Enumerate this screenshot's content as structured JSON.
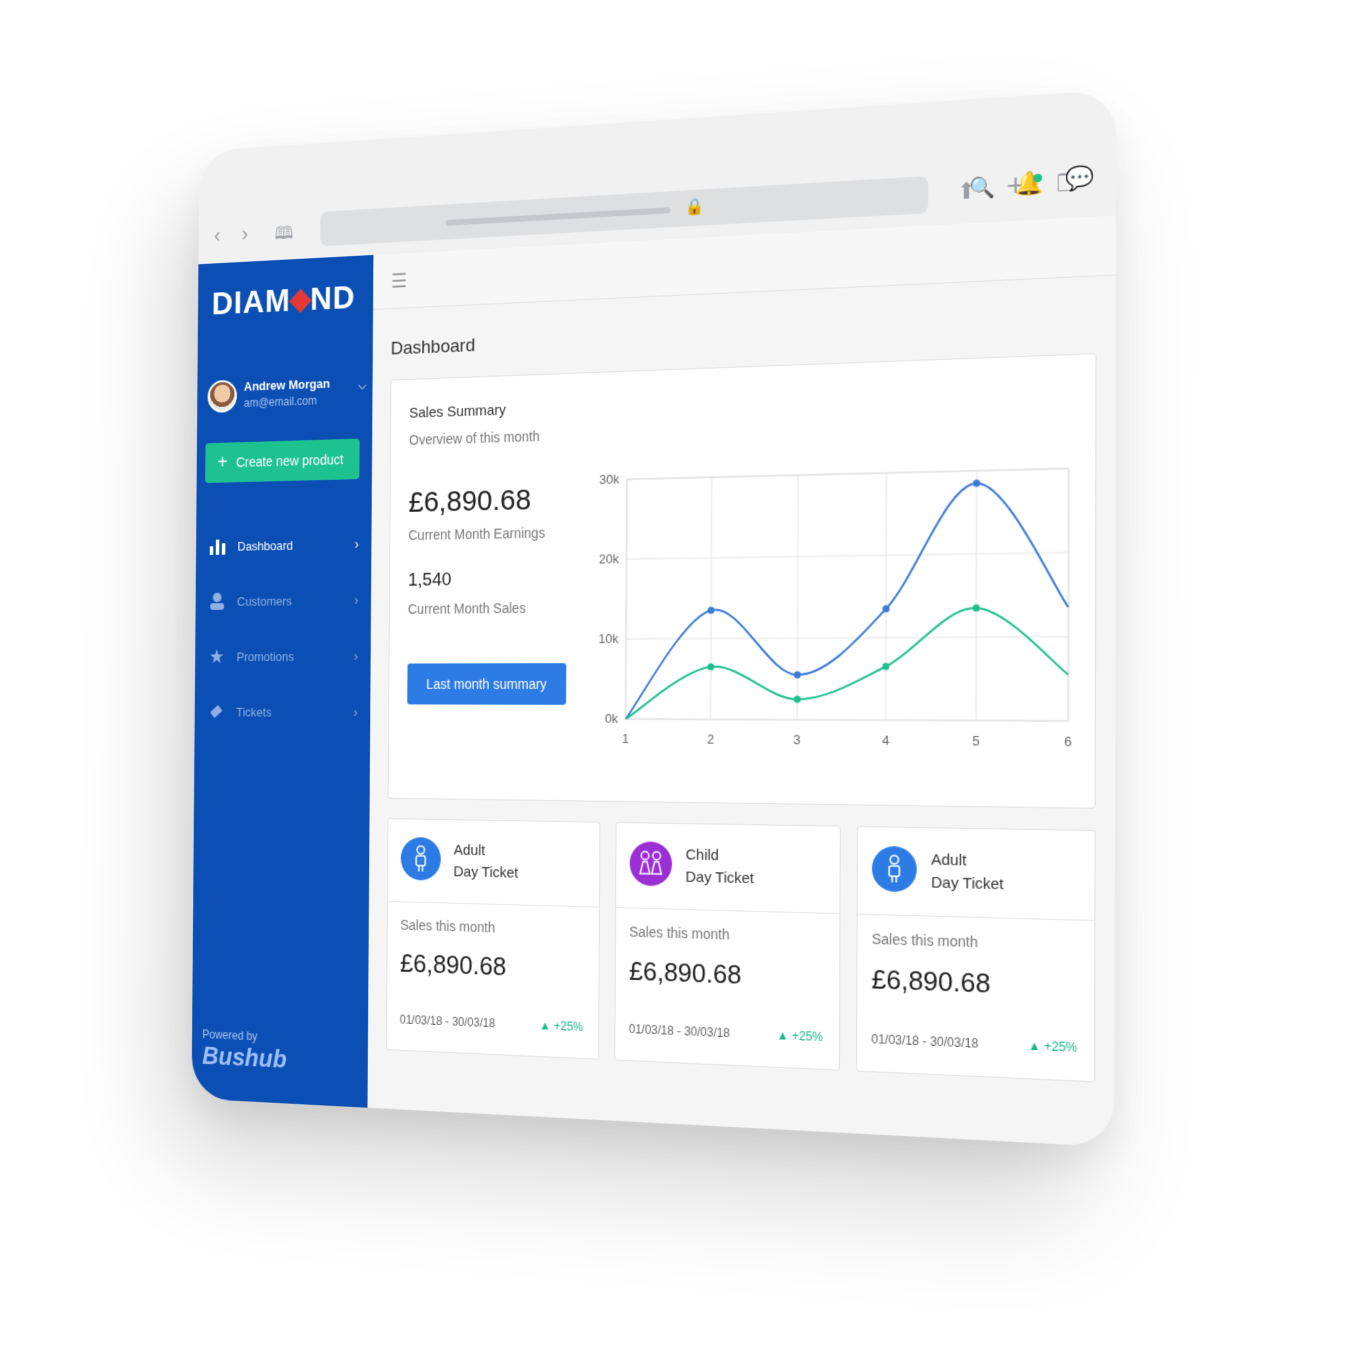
{
  "brand": {
    "logo_left": "DIAM",
    "logo_right": "ND"
  },
  "user": {
    "name": "Andrew Morgan",
    "email": "am@email.com"
  },
  "sidebar": {
    "create_label": "Create new product",
    "items": [
      {
        "label": "Dashboard",
        "icon": "bar-chart-icon"
      },
      {
        "label": "Customers",
        "icon": "user-icon"
      },
      {
        "label": "Promotions",
        "icon": "star-icon"
      },
      {
        "label": "Tickets",
        "icon": "ticket-icon"
      }
    ],
    "powered_by": "Powered by",
    "powered_brand": "Bushub"
  },
  "main": {
    "title": "Dashboard",
    "summary": {
      "title": "Sales Summary",
      "subtitle": "Overview of this month",
      "earnings": "£6,890.68",
      "earnings_label": "Current Month Earnings",
      "sales": "1,540",
      "sales_label": "Current Month Sales",
      "button": "Last month summary"
    },
    "cards": [
      {
        "title1": "Adult",
        "title2": "Day Ticket",
        "label": "Sales this month",
        "value": "£6,890.68",
        "range": "01/03/18 - 30/03/18",
        "delta": "▲ +25%",
        "icon_color": "#2d7be5"
      },
      {
        "title1": "Child",
        "title2": "Day Ticket",
        "label": "Sales this month",
        "value": "£6,890.68",
        "range": "01/03/18 - 30/03/18",
        "delta": "▲ +25%",
        "icon_color": "#9b2fd6"
      },
      {
        "title1": "Adult",
        "title2": "Day Ticket",
        "label": "Sales this month",
        "value": "£6,890.68",
        "range": "01/03/18 - 30/03/18",
        "delta": "▲ +25%",
        "icon_color": "#2d7be5"
      }
    ]
  },
  "colors": {
    "sidebar": "#0b4fb5",
    "accent_green": "#1ec28f",
    "accent_blue": "#2d7be5"
  },
  "chart_data": {
    "type": "line",
    "x": [
      1,
      2,
      3,
      4,
      5,
      6
    ],
    "yticks": [
      "0k",
      "10k",
      "20k",
      "30k"
    ],
    "ylim": [
      0,
      30000
    ],
    "grid": true,
    "series": [
      {
        "values": [
          0,
          13500,
          5500,
          13500,
          28500,
          13500
        ],
        "color": "#3a7bd5"
      },
      {
        "values": [
          0,
          6500,
          2500,
          6500,
          13500,
          5500
        ],
        "color": "#1fbf8f"
      }
    ]
  }
}
